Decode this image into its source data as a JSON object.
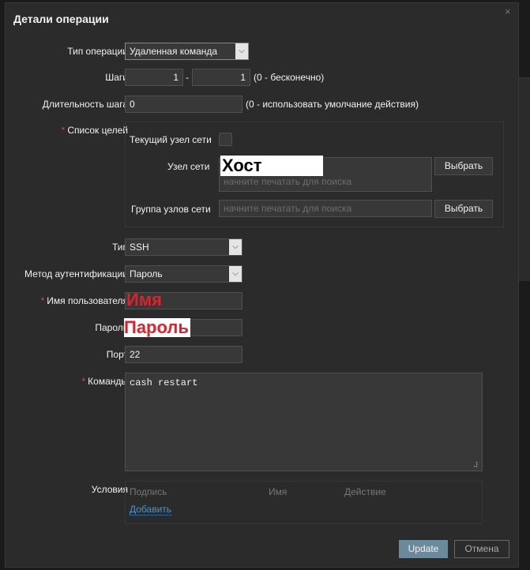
{
  "dialog": {
    "title": "Детали операции",
    "close": "×"
  },
  "form": {
    "op_type": {
      "label": "Тип операции",
      "value": "Удаленная команда"
    },
    "steps": {
      "label": "Шаги",
      "from": "1",
      "sep": "-",
      "to": "1",
      "hint": "(0 - бесконечно)"
    },
    "step_duration": {
      "label": "Длительность шага",
      "value": "0",
      "hint": "(0 - использовать умолчание действия)"
    },
    "targets": {
      "label": "Список целей",
      "current_host": "Текущий узел сети",
      "host": "Узел сети",
      "host_value": "Хост",
      "host_placeholder": "начните печатать для поиска",
      "group": "Группа узлов сети",
      "group_placeholder": "начните печатать для поиска",
      "select": "Выбрать"
    },
    "type": {
      "label": "Тип",
      "value": "SSH"
    },
    "auth": {
      "label": "Метод аутентификации",
      "value": "Пароль"
    },
    "username": {
      "label": "Имя пользователя",
      "value": "Имя"
    },
    "password": {
      "label": "Пароль",
      "value": "Пароль"
    },
    "port": {
      "label": "Порт",
      "value": "22"
    },
    "commands": {
      "label": "Команды",
      "value": "cash restart"
    },
    "conditions": {
      "label": "Условия",
      "columns": [
        "Подпись",
        "Имя",
        "Действие"
      ],
      "add": "Добавить"
    }
  },
  "buttons": {
    "update": "Update",
    "cancel": "Отмена"
  },
  "required_mark": "*"
}
